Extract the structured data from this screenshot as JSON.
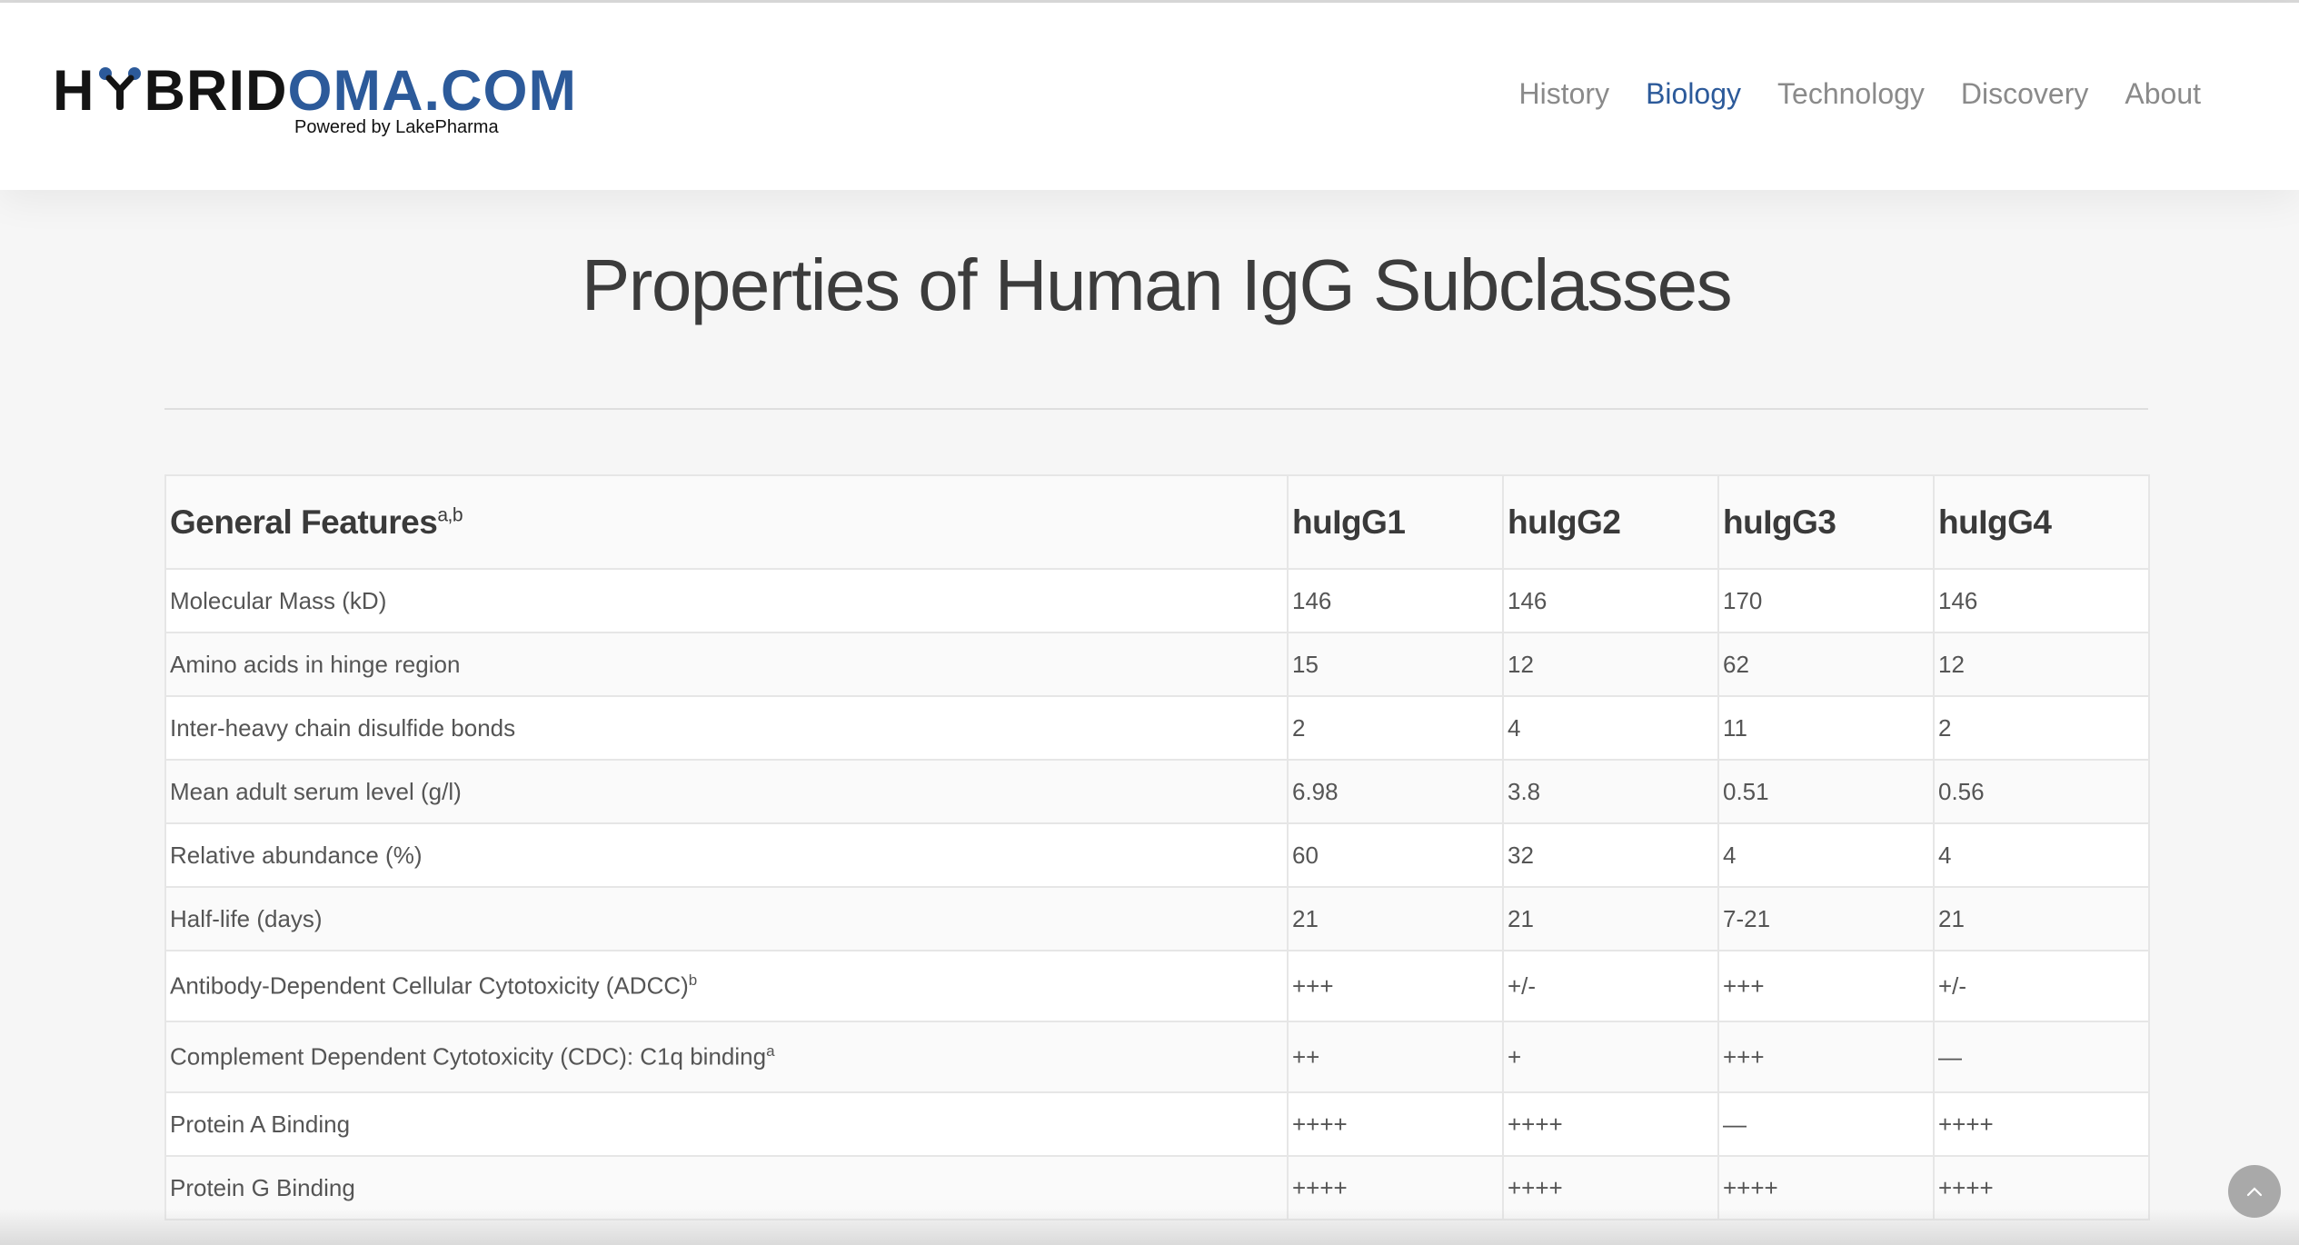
{
  "brand": {
    "logo_prefix": "H",
    "logo_rest_dark": "BRID",
    "logo_rest_blue": "OMA.COM",
    "tagline": "Powered by LakePharma",
    "dark_color": "#141414",
    "blue_color": "#2c5a9a"
  },
  "nav": {
    "items": [
      {
        "label": "History"
      },
      {
        "label": "Biology"
      },
      {
        "label": "Technology"
      },
      {
        "label": "Discovery"
      },
      {
        "label": "About"
      }
    ],
    "active": "Biology"
  },
  "page": {
    "title": "Properties of Human IgG Subclasses"
  },
  "table": {
    "header": {
      "feature": "General Features",
      "feature_sup": "a,b",
      "cols": [
        "huIgG1",
        "huIgG2",
        "huIgG3",
        "huIgG4"
      ]
    },
    "rows": [
      {
        "label": "Molecular Mass (kD)",
        "sup": "",
        "values": [
          "146",
          "146",
          "170",
          "146"
        ]
      },
      {
        "label": "Amino acids in hinge region",
        "sup": "",
        "values": [
          "15",
          "12",
          "62",
          "12"
        ]
      },
      {
        "label": "Inter-heavy chain disulfide bonds",
        "sup": "",
        "values": [
          "2",
          "4",
          "11",
          "2"
        ]
      },
      {
        "label": "Mean adult serum level (g/l)",
        "sup": "",
        "values": [
          "6.98",
          "3.8",
          "0.51",
          "0.56"
        ]
      },
      {
        "label": "Relative abundance (%)",
        "sup": "",
        "values": [
          "60",
          "32",
          "4",
          "4"
        ]
      },
      {
        "label": "Half-life (days)",
        "sup": "",
        "values": [
          "21",
          "21",
          "7-21",
          "21"
        ]
      },
      {
        "label": "Antibody-Dependent Cellular Cytotoxicity (ADCC)",
        "sup": "b",
        "values": [
          "+++",
          "+/-",
          "+++",
          "+/-"
        ]
      },
      {
        "label": "Complement Dependent Cytotoxicity (CDC): C1q binding",
        "sup": "a",
        "values": [
          "++",
          "+",
          "+++",
          "—"
        ]
      },
      {
        "label": "Protein A Binding",
        "sup": "",
        "values": [
          "++++",
          "++++",
          "—",
          "++++"
        ]
      },
      {
        "label": "Protein G Binding",
        "sup": "",
        "values": [
          "++++",
          "++++",
          "++++",
          "++++"
        ]
      }
    ]
  },
  "scroll_to_top": {
    "icon": "chevron-up-icon"
  }
}
